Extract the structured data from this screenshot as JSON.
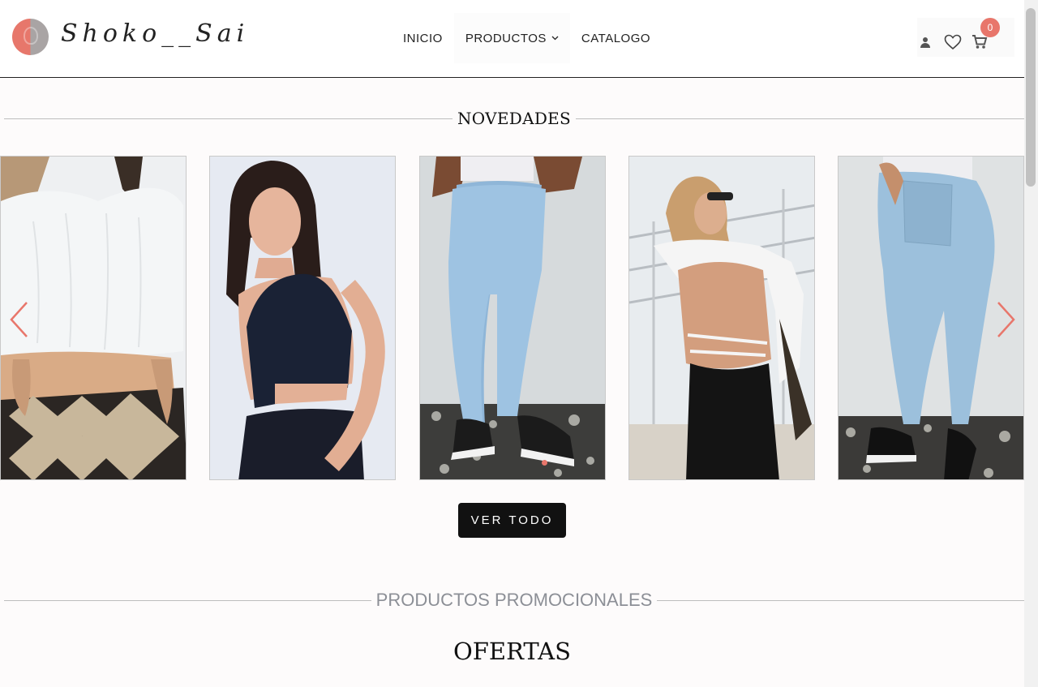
{
  "brand": {
    "name": "Shoko__Sai"
  },
  "nav": {
    "items": [
      {
        "label": "INICIO"
      },
      {
        "label": "PRODUCTOS"
      },
      {
        "label": "CATALOGO"
      }
    ]
  },
  "header_icons": {
    "user": "user-icon",
    "wishlist": "heart-icon",
    "cart": "cart-icon",
    "cart_count": "0"
  },
  "sections": {
    "novedades_title": "NOVEDADES",
    "ver_todo_label": "VER TODO",
    "promo_title": "PRODUCTOS PROMOCIONALES",
    "ofertas_title": "OFERTAS"
  },
  "carousel": {
    "cards": [
      {
        "name": "white-crop-top-argyle-skirt"
      },
      {
        "name": "black-halter-crop-top"
      },
      {
        "name": "light-blue-skinny-jeans-front"
      },
      {
        "name": "white-open-back-top"
      },
      {
        "name": "light-blue-skinny-jeans-back"
      }
    ]
  },
  "colors": {
    "accent": "#e8766b",
    "button_bg": "#111111",
    "muted_title": "#8c8f96"
  }
}
